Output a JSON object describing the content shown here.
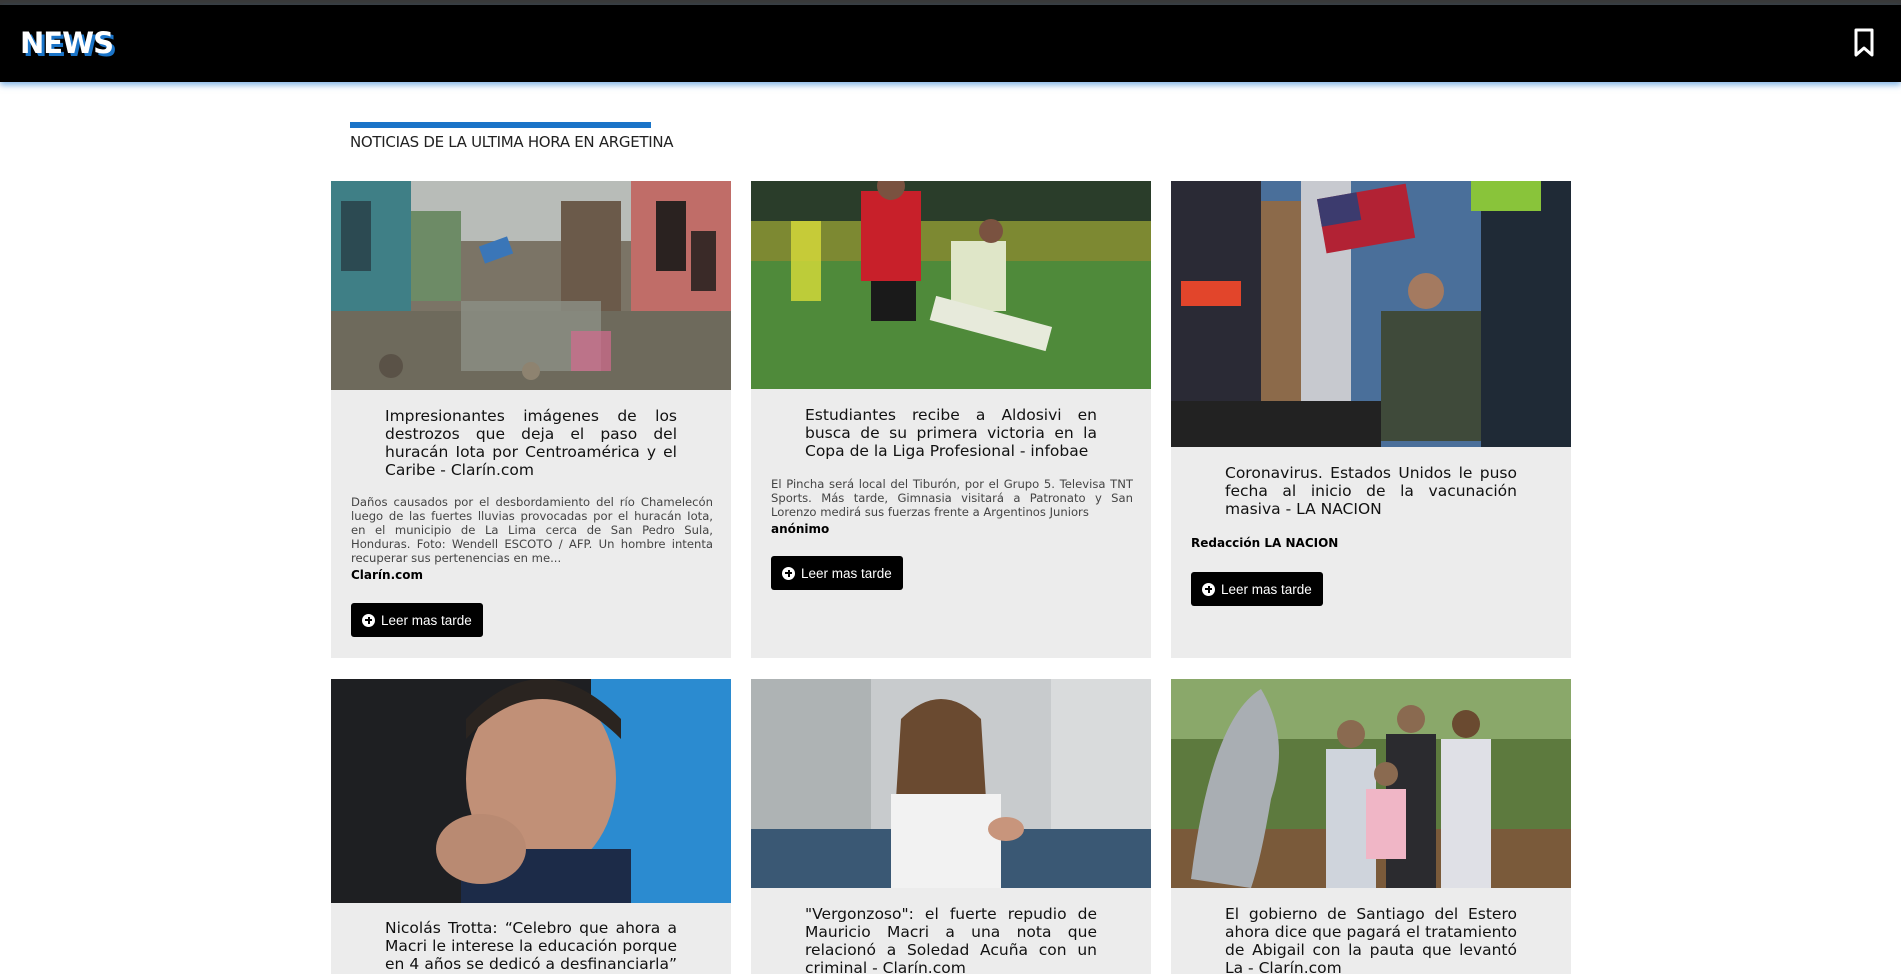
{
  "header": {
    "logo": "NEWS",
    "bookmark_icon": "bookmark-icon"
  },
  "section": {
    "title": "NOTICIAS DE LA ULTIMA HORA EN ARGETINA",
    "accent": "#1a74c8"
  },
  "articles": [
    {
      "title": "Impresionantes imágenes de los destrozos que deja el paso del huracán Iota por Centroamérica y el Caribe - Clarín.com",
      "description": "Daños causados por el desbordamiento del río Chamelecón luego de las fuertes lluvias provocadas por el huracán Iota, en el municipio de La Lima cerca de San Pedro Sula, Honduras. Foto: Wendell ESCOTO / AFP. Un hombre intenta recuperar sus pertenencias en me...",
      "source": "Clarín.com",
      "button": "Leer mas tarde"
    },
    {
      "title": "Estudiantes recibe a Aldosivi en busca de su primera victoria en la Copa de la Liga Profesional - infobae",
      "description": "El Pincha será local del Tiburón, por el Grupo 5. Televisa TNT Sports. Más tarde, Gimnasia visitará a Patronato y San Lorenzo medirá sus fuerzas frente a Argentinos Juniors",
      "source": "anónimo",
      "button": "Leer mas tarde"
    },
    {
      "title": "Coronavirus. Estados Unidos le puso fecha al inicio de la vacunación masiva - LA NACION",
      "description": "",
      "source": "Redacción LA NACION",
      "button": "Leer mas tarde"
    },
    {
      "title": "Nicolás Trotta: “Celebro que ahora a Macri le interese la educación porque en 4 años se dedicó a desfinanciarla” -",
      "description": "",
      "source": "",
      "button": ""
    },
    {
      "title": "\"Vergonzoso\": el fuerte repudio de Mauricio Macri a una nota que relacionó a Soledad Acuña con un criminal - Clarín.com",
      "description": "",
      "source": "",
      "button": ""
    },
    {
      "title": "El gobierno de Santiago del Estero ahora dice que pagará el tratamiento de Abigail con la pauta que levantó La - Clarín.com",
      "description": "",
      "source": "",
      "button": ""
    }
  ]
}
